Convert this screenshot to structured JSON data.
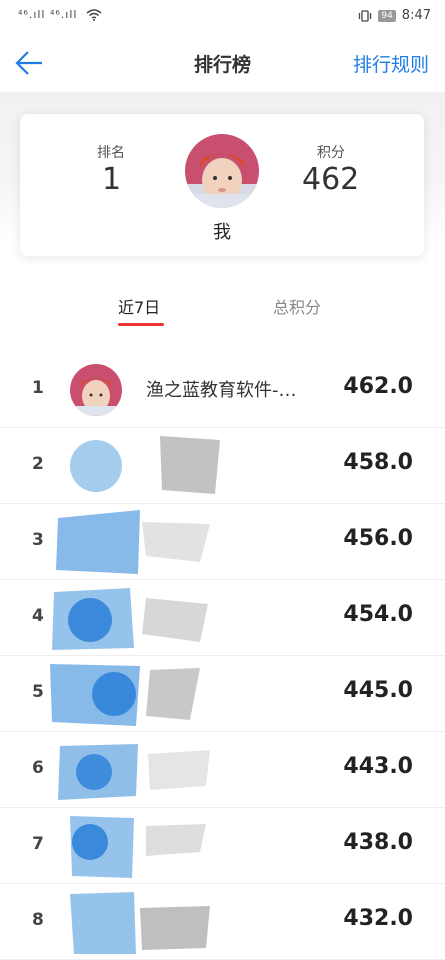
{
  "status_bar": {
    "signal": "⁴⁶.ıll ⁴⁶.ıll",
    "battery": "94",
    "time": "8:47"
  },
  "header": {
    "title": "排行榜",
    "rules_link": "排行规则"
  },
  "me": {
    "rank_label": "排名",
    "rank": "1",
    "score_label": "积分",
    "score": "462",
    "name": "我"
  },
  "tabs": [
    {
      "label": "近7日"
    },
    {
      "label": "总积分"
    }
  ],
  "list": [
    {
      "rank": "1",
      "name": "渔之蓝教育软件-…",
      "score": "462.0"
    },
    {
      "rank": "2",
      "name": "",
      "score": "458.0"
    },
    {
      "rank": "3",
      "name": "",
      "score": "456.0"
    },
    {
      "rank": "4",
      "name": "",
      "score": "454.0"
    },
    {
      "rank": "5",
      "name": "",
      "score": "445.0"
    },
    {
      "rank": "6",
      "name": "",
      "score": "443.0"
    },
    {
      "rank": "7",
      "name": "",
      "score": "438.0"
    },
    {
      "rank": "8",
      "name": "",
      "score": "432.0"
    }
  ],
  "icons": {
    "back": "arrow-left-icon",
    "wifi": "wifi-icon",
    "vibrate": "vibrate-icon"
  },
  "colors": {
    "accent": "#1f7ee6",
    "tab_underline": "#e33333"
  }
}
